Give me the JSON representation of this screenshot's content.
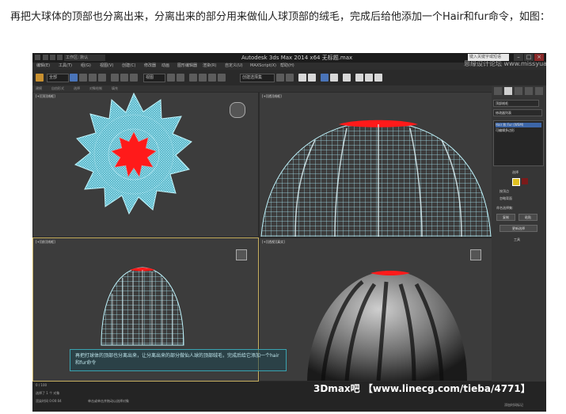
{
  "caption": "再把大球体的顶部也分离出来，分离出来的部分用来做仙人球顶部的绒毛，完成后给他添加一个Hair和fur命令，如图：",
  "window": {
    "title": "Autodesk 3ds Max 2014 x64    无标题.max",
    "workspace": "工作区: 默认",
    "search_placeholder": "键入关键字或短语",
    "watermark": "思缘设计论坛 www.missyuan.com"
  },
  "menu": [
    "编辑(E)",
    "工具(T)",
    "组(G)",
    "视图(V)",
    "创建(C)",
    "修改器",
    "动画",
    "图形编辑器",
    "渲染(R)",
    "自定义(U)",
    "MAXScript(X)",
    "帮助(H)"
  ],
  "toolbar": {
    "filter_value": "全部",
    "view_value": "视图",
    "selection_set_placeholder": "创建选择集"
  },
  "ribbon": [
    "建模",
    "自由形式",
    "选择",
    "对象绘制",
    "填充"
  ],
  "viewports": {
    "top_left": "[+][顶][线框]",
    "top_right": "[+][透][线框]",
    "bottom_left": "[+][前][线框]",
    "bottom_right": "[+][透视][真实]"
  },
  "command_panel": {
    "object_name": "顶部绒毛",
    "modifier_list": "修改器列表",
    "modifiers": [
      "Hair 和 Fur (WSM)",
      "可编辑多边形"
    ],
    "selection_header": "选择",
    "by_vertex": "按顶点",
    "ignore_backfacing": "忽略背面",
    "named_selection": "命名选择集:",
    "copy_label": "复制",
    "paste_label": "粘贴",
    "update_selection": "更新选择",
    "tools_header": "工具"
  },
  "subtitle": "再把打球体的顶部也分离出来，让分离出来的部分做仙人球的顶部绒毛，完成后给它添加一个hair和fur命令",
  "status": {
    "timeline": "0 / 100",
    "selected": "选择了 1 个 对象",
    "render_time": "渲染时间  0:00:04",
    "prompt": "单击或单击并拖动以选择对象",
    "add_time_tag": "添加时间标记"
  },
  "brand": "3Dmax吧  【www.linecg.com/tieba/4771】",
  "colors": {
    "wire": "#7fd3e6",
    "top": "#ff1a1a",
    "bg": "#3b3b3b"
  }
}
